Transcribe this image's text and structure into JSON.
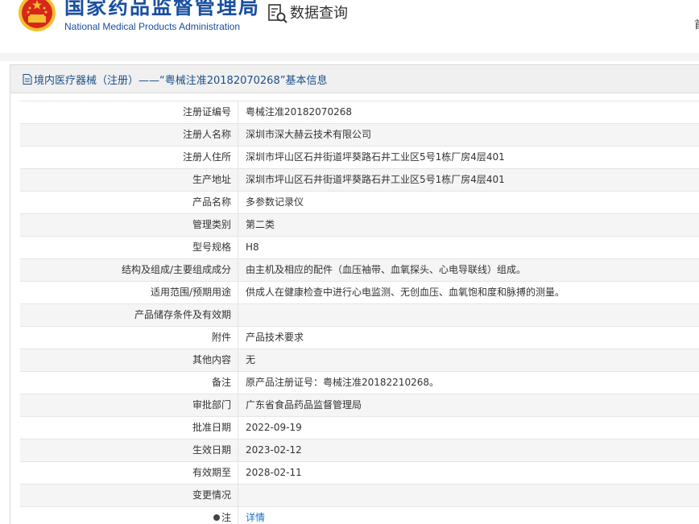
{
  "header": {
    "title_cn": "国家药品监督管理局",
    "title_en": "National Medical Products Administration",
    "query_label": "数据查询",
    "cut_text": "首"
  },
  "panel": {
    "title": "境内医疗器械（注册）——“粤械注准20182070268”基本信息"
  },
  "rows": [
    {
      "label": "注册证编号",
      "value": "粤械注准20182070268"
    },
    {
      "label": "注册人名称",
      "value": "深圳市深大赫云技术有限公司"
    },
    {
      "label": "注册人住所",
      "value": "深圳市坪山区石井街道坪葵路石井工业区5号1栋厂房4层401"
    },
    {
      "label": "生产地址",
      "value": "深圳市坪山区石井街道坪葵路石井工业区5号1栋厂房4层401"
    },
    {
      "label": "产品名称",
      "value": "多参数记录仪"
    },
    {
      "label": "管理类别",
      "value": "第二类"
    },
    {
      "label": "型号规格",
      "value": "H8"
    },
    {
      "label": "结构及组成/主要组成成分",
      "value": "由主机及相应的配件（血压袖带、血氧探头、心电导联线）组成。"
    },
    {
      "label": "适用范围/预期用途",
      "value": "供成人在健康检查中进行心电监测、无创血压、血氧饱和度和脉搏的测量。"
    },
    {
      "label": "产品储存条件及有效期",
      "value": ""
    },
    {
      "label": "附件",
      "value": "产品技术要求"
    },
    {
      "label": "其他内容",
      "value": "无"
    },
    {
      "label": "备注",
      "value": "原产品注册证号：粤械注准20182210268。"
    },
    {
      "label": "审批部门",
      "value": "广东省食品药品监督管理局"
    },
    {
      "label": "批准日期",
      "value": "2022-09-19"
    },
    {
      "label": "生效日期",
      "value": "2023-02-12"
    },
    {
      "label": "有效期至",
      "value": "2028-02-11"
    },
    {
      "label": "变更情况",
      "value": ""
    }
  ],
  "note_row": {
    "label": "注",
    "link": "详情"
  },
  "colors": {
    "brand": "#1a4fa1",
    "link": "#1a6fc4",
    "emblem_red": "#d9261c",
    "emblem_gold": "#f2c12e"
  }
}
